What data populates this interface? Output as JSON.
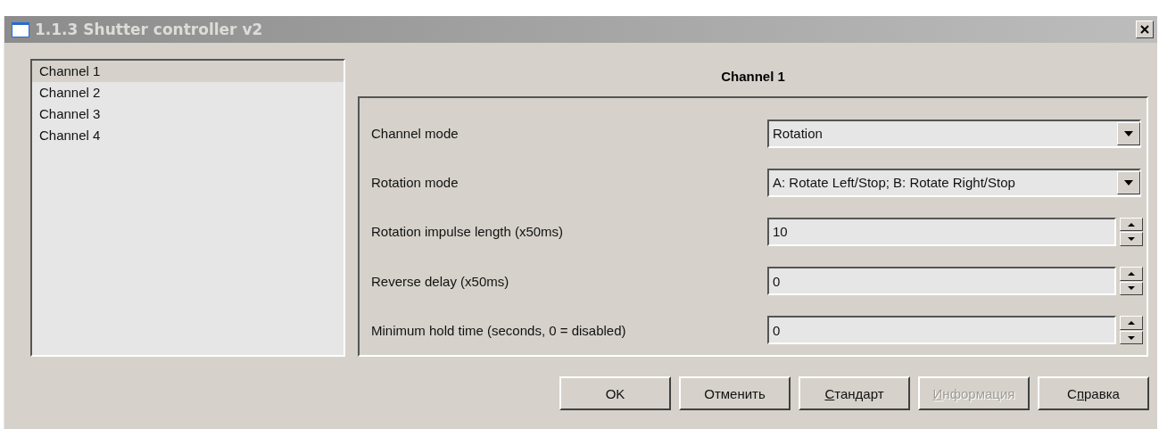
{
  "window": {
    "title": "1.1.3 Shutter controller v2"
  },
  "channels": [
    {
      "label": "Channel 1",
      "selected": true
    },
    {
      "label": "Channel 2",
      "selected": false
    },
    {
      "label": "Channel 3",
      "selected": false
    },
    {
      "label": "Channel 4",
      "selected": false
    }
  ],
  "panel": {
    "heading": "Channel 1",
    "settings": [
      {
        "kind": "dropdown",
        "label": "Channel mode",
        "value": "Rotation"
      },
      {
        "kind": "dropdown",
        "label": "Rotation mode",
        "value": "A: Rotate Left/Stop; B: Rotate Right/Stop"
      },
      {
        "kind": "spinner",
        "label": "Rotation impulse length (x50ms)",
        "value": "10"
      },
      {
        "kind": "spinner",
        "label": "Reverse delay (x50ms)",
        "value": "0"
      },
      {
        "kind": "spinner",
        "label": "Minimum hold time (seconds, 0 = disabled)",
        "value": "0"
      }
    ]
  },
  "buttons": [
    {
      "label": "OK",
      "disabled": false
    },
    {
      "label": "Отменить",
      "disabled": false
    },
    {
      "parts": [
        {
          "text": "С",
          "underlined": true
        },
        {
          "text": "тандарт",
          "underlined": false
        }
      ],
      "disabled": false
    },
    {
      "parts": [
        {
          "text": "И",
          "underlined": true
        },
        {
          "text": "нформация",
          "underlined": false
        }
      ],
      "disabled": true
    },
    {
      "parts": [
        {
          "text": "С",
          "underlined": false
        },
        {
          "text": "п",
          "underlined": true
        },
        {
          "text": "равка",
          "underlined": false
        }
      ],
      "disabled": false
    }
  ]
}
